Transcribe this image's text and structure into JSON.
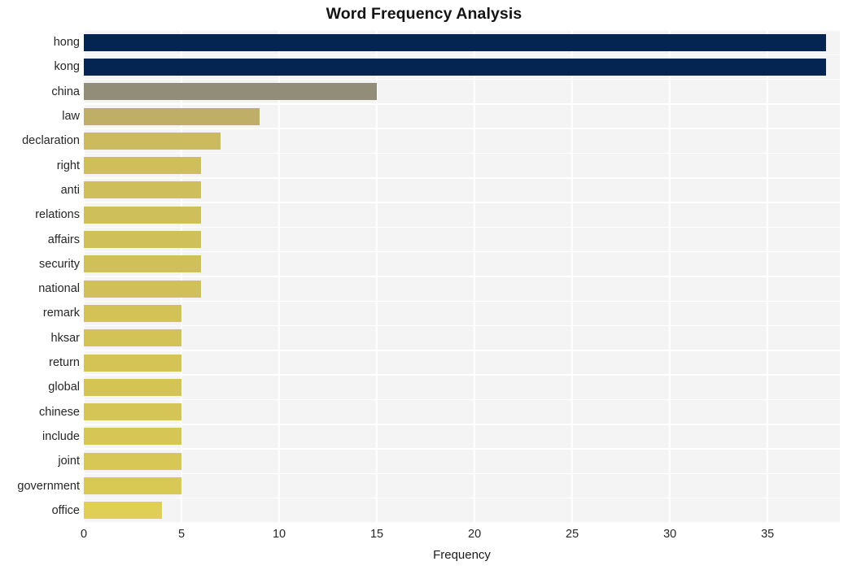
{
  "chart_data": {
    "type": "bar",
    "orientation": "horizontal",
    "title": "Word Frequency Analysis",
    "xlabel": "Frequency",
    "ylabel": "",
    "categories": [
      "hong",
      "kong",
      "china",
      "law",
      "declaration",
      "right",
      "anti",
      "relations",
      "affairs",
      "security",
      "national",
      "remark",
      "hksar",
      "return",
      "global",
      "chinese",
      "include",
      "joint",
      "government",
      "office"
    ],
    "values": [
      38,
      38,
      15,
      9,
      7,
      6,
      6,
      6,
      6,
      6,
      6,
      5,
      5,
      5,
      5,
      5,
      5,
      5,
      5,
      4
    ],
    "bar_colors": [
      "#042552",
      "#042552",
      "#928d79",
      "#bfae66",
      "#cbbb5e",
      "#cfbf5b",
      "#cfbf5b",
      "#cfbf5b",
      "#d0c05a",
      "#d0c05a",
      "#d0c05a",
      "#d3c357",
      "#d3c357",
      "#d4c456",
      "#d4c456",
      "#d5c556",
      "#d6c655",
      "#d7c755",
      "#d8c854",
      "#e0cf55"
    ],
    "xlim": [
      0,
      38.7
    ],
    "x_ticks": [
      0,
      5,
      10,
      15,
      20,
      25,
      30,
      35
    ],
    "x_tick_labels": [
      "0",
      "5",
      "10",
      "15",
      "20",
      "25",
      "30",
      "35"
    ],
    "grid": true,
    "grid_color": "#ffffff",
    "plot_background": "#f4f4f4",
    "figure_background": "#ffffff",
    "legend": null
  }
}
